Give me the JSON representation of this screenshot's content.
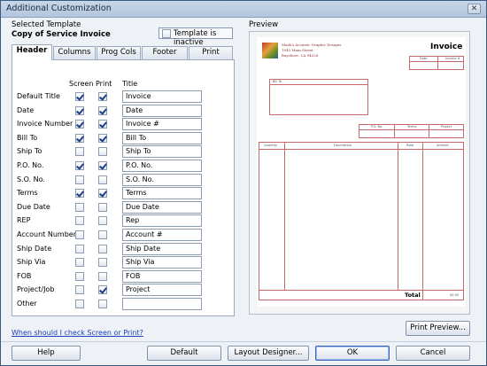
{
  "window": {
    "title": "Additional Customization",
    "close_glyph": "✕"
  },
  "template": {
    "selected_label": "Selected Template",
    "name": "Copy of Service Invoice",
    "inactive_label": "Template is inactive",
    "inactive_checked": false
  },
  "tabs": [
    {
      "label": "Header",
      "active": true
    },
    {
      "label": "Columns",
      "active": false
    },
    {
      "label": "Prog Cols",
      "active": false
    },
    {
      "label": "Footer",
      "active": false
    },
    {
      "label": "Print",
      "active": false
    }
  ],
  "columns": {
    "screen": "Screen",
    "print": "Print",
    "title": "Title"
  },
  "fields": [
    {
      "name": "Default Title",
      "screen": true,
      "print": true,
      "title": "Invoice"
    },
    {
      "name": "Date",
      "screen": true,
      "print": true,
      "title": "Date"
    },
    {
      "name": "Invoice Number",
      "screen": true,
      "print": true,
      "title": "Invoice #"
    },
    {
      "name": "Bill To",
      "screen": true,
      "print": true,
      "title": "Bill To"
    },
    {
      "name": "Ship To",
      "screen": false,
      "print": false,
      "title": "Ship To"
    },
    {
      "name": "P.O. No.",
      "screen": true,
      "print": true,
      "title": "P.O. No."
    },
    {
      "name": "S.O. No.",
      "screen": false,
      "print": false,
      "title": "S.O. No."
    },
    {
      "name": "Terms",
      "screen": true,
      "print": true,
      "title": "Terms"
    },
    {
      "name": "Due Date",
      "screen": false,
      "print": false,
      "title": "Due Date"
    },
    {
      "name": "REP",
      "screen": false,
      "print": false,
      "title": "Rep"
    },
    {
      "name": "Account Number",
      "screen": false,
      "print": false,
      "title": "Account #"
    },
    {
      "name": "Ship Date",
      "screen": false,
      "print": false,
      "title": "Ship Date"
    },
    {
      "name": "Ship Via",
      "screen": false,
      "print": false,
      "title": "Ship Via"
    },
    {
      "name": "FOB",
      "screen": false,
      "print": false,
      "title": "FOB"
    },
    {
      "name": "Project/Job",
      "screen": false,
      "print": true,
      "title": "Project"
    },
    {
      "name": "Other",
      "screen": false,
      "print": false,
      "title": ""
    }
  ],
  "help_link": "When should I check Screen or Print?",
  "preview": {
    "label": "Preview",
    "company_lines": [
      "Mark's Acoustic Graphic Designs",
      "1043 Main Street",
      "Bayshore, CA 94326"
    ],
    "invoice_title": "Invoice",
    "date_label": "Date",
    "invno_label": "Invoice #",
    "billto_label": "Bill To",
    "po_label": "P.O. No.",
    "terms_label": "Terms",
    "project_label": "Project",
    "qty_label": "Quantity",
    "desc_label": "Description",
    "rate_label": "Rate",
    "amount_label": "Amount",
    "total_label": "Total",
    "total_value": "$0.00",
    "print_preview_button": "Print Preview..."
  },
  "buttons": {
    "help": "Help",
    "default": "Default",
    "layout": "Layout Designer...",
    "ok": "OK",
    "cancel": "Cancel"
  },
  "colors": {
    "accent": "#3b66b5",
    "preview_line": "#c46a6a"
  }
}
